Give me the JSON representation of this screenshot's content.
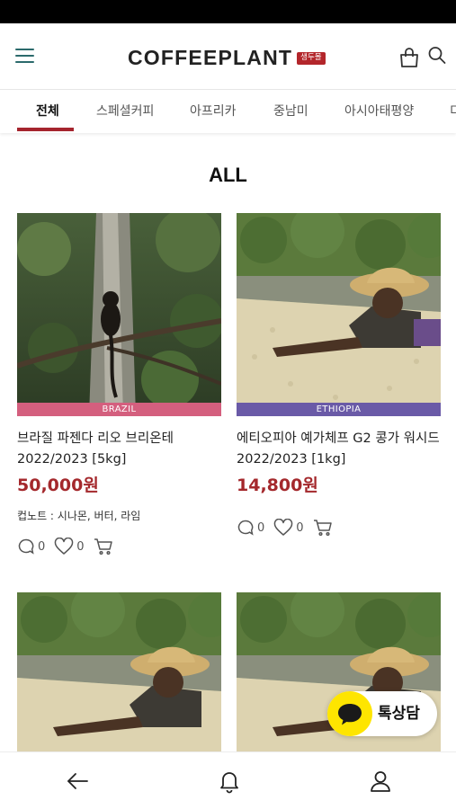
{
  "header": {
    "logo_text": "COFFEEPLANT",
    "logo_badge": "생두몰",
    "menu_icon": "hamburger-menu-icon",
    "cart_icon": "shopping-bag-icon",
    "search_icon": "search-icon"
  },
  "tabs": [
    {
      "label": "전체",
      "active": true
    },
    {
      "label": "스페셜커피",
      "active": false
    },
    {
      "label": "아프리카",
      "active": false
    },
    {
      "label": "중남미",
      "active": false
    },
    {
      "label": "아시아태평양",
      "active": false
    },
    {
      "label": "디",
      "active": false
    }
  ],
  "section_title": "ALL",
  "products": [
    {
      "origin": "BRAZIL",
      "origin_color": "#d45f7e",
      "name": "브라질 파젠다 리오 브리온테 2022/2023 [5kg]",
      "price": "50,000원",
      "note": "컵노트 : 시나몬, 버터, 라임",
      "comments": "0",
      "likes": "0"
    },
    {
      "origin": "ETHIOPIA",
      "origin_color": "#6a5aa7",
      "name": "에티오피아 예가체프 G2 콩가 워시드 2022/2023 [1kg]",
      "price": "14,800원",
      "note": "",
      "comments": "0",
      "likes": "0"
    },
    {
      "origin": "",
      "name": "",
      "price": ""
    },
    {
      "origin": "",
      "name": "",
      "price": ""
    }
  ],
  "chat": {
    "label": "톡상담",
    "icon": "kakaotalk-chat-icon",
    "color": "#fee500"
  },
  "bottom_nav": {
    "back_icon": "back-arrow-icon",
    "notification_icon": "bell-icon",
    "account_icon": "user-icon"
  },
  "colors": {
    "accent": "#a5242e",
    "price": "#a4282c"
  }
}
